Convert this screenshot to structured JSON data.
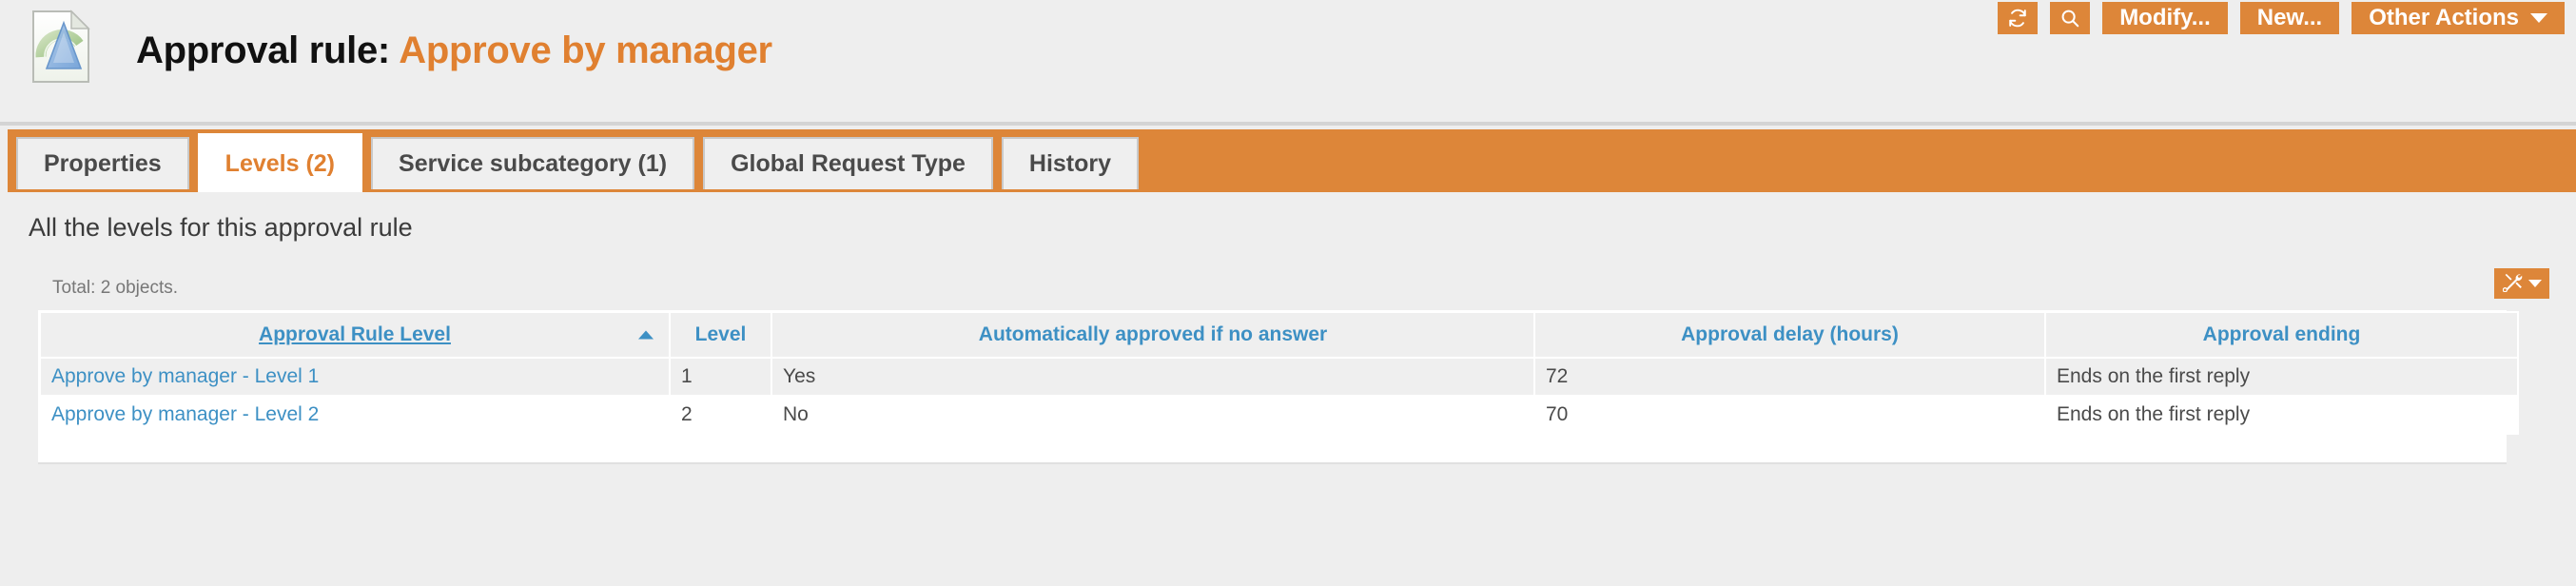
{
  "header": {
    "icon": "approval-rule-document-icon",
    "title_prefix": "Approval rule:",
    "title_value": "Approve by manager",
    "accent_color": "#e08030"
  },
  "toolbar": {
    "refresh_icon": "refresh-icon",
    "search_icon": "search-icon",
    "modify_label": "Modify...",
    "new_label": "New...",
    "other_actions_label": "Other Actions",
    "button_color": "#dd8639"
  },
  "tabs": [
    {
      "label": "Properties",
      "active": false
    },
    {
      "label": "Levels (2)",
      "active": true
    },
    {
      "label": "Service subcategory (1)",
      "active": false
    },
    {
      "label": "Global Request Type",
      "active": false
    },
    {
      "label": "History",
      "active": false
    }
  ],
  "main": {
    "section_title": "All the levels for this approval rule",
    "total_text": "Total: 2 objects.",
    "tools_icon": "tools-icon"
  },
  "table": {
    "columns": [
      {
        "label": "Approval Rule Level",
        "sorted": true,
        "sort_dir": "asc"
      },
      {
        "label": "Level",
        "sorted": false
      },
      {
        "label": "Automatically approved if no answer",
        "sorted": false
      },
      {
        "label": "Approval delay (hours)",
        "sorted": false
      },
      {
        "label": "Approval ending",
        "sorted": false
      }
    ],
    "rows": [
      {
        "name": "Approve by manager - Level 1",
        "level": "1",
        "auto_approved": "Yes",
        "delay": "72",
        "ending": "Ends on the first reply"
      },
      {
        "name": "Approve by manager - Level 2",
        "level": "2",
        "auto_approved": "No",
        "delay": "70",
        "ending": "Ends on the first reply"
      }
    ]
  }
}
